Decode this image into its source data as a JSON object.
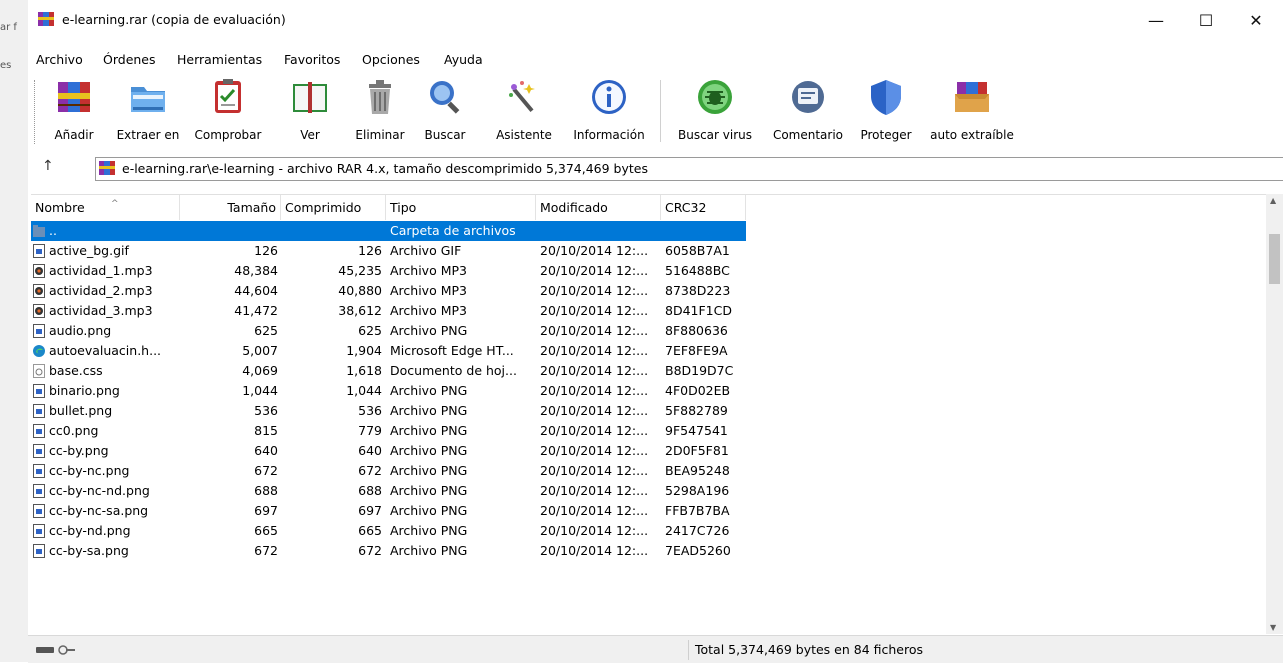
{
  "left_edge": {
    "texts": [
      "ar f",
      "es"
    ]
  },
  "window": {
    "title": "e-learning.rar (copia de evaluación)",
    "minimize": "—",
    "maximize": "☐",
    "close": "✕"
  },
  "menu": [
    "Archivo",
    "Órdenes",
    "Herramientas",
    "Favoritos",
    "Opciones",
    "Ayuda"
  ],
  "toolbar": [
    {
      "label": "Añadir",
      "icon": "add-books-icon"
    },
    {
      "label": "Extraer en",
      "icon": "extract-folder-icon"
    },
    {
      "label": "Comprobar",
      "icon": "test-clipboard-icon"
    },
    {
      "label": "Ver",
      "icon": "view-book-icon"
    },
    {
      "label": "Eliminar",
      "icon": "trash-icon"
    },
    {
      "label": "Buscar",
      "icon": "magnifier-icon"
    },
    {
      "label": "Asistente",
      "icon": "wizard-wand-icon"
    },
    {
      "label": "Información",
      "icon": "info-icon"
    },
    {
      "label": "Buscar virus",
      "icon": "virus-scan-icon"
    },
    {
      "label": "Comentario",
      "icon": "comment-icon"
    },
    {
      "label": "Proteger",
      "icon": "shield-icon"
    },
    {
      "label": "auto extraíble",
      "icon": "sfx-box-icon"
    }
  ],
  "address": {
    "up": "↑",
    "path": "e-learning.rar\\e-learning - archivo RAR 4.x, tamaño descomprimido 5,374,469 bytes"
  },
  "columns": {
    "name": "Nombre",
    "size": "Tamaño",
    "packed": "Comprimido",
    "type": "Tipo",
    "modified": "Modificado",
    "crc": "CRC32"
  },
  "rows": [
    {
      "name": "..",
      "size": "",
      "packed": "",
      "type": "Carpeta de archivos",
      "modified": "",
      "crc": "",
      "icon": "folder-up-icon",
      "selected": true
    },
    {
      "name": "active_bg.gif",
      "size": "126",
      "packed": "126",
      "type": "Archivo GIF",
      "modified": "20/10/2014 12:...",
      "crc": "6058B7A1",
      "icon": "image-file-icon"
    },
    {
      "name": "actividad_1.mp3",
      "size": "48,384",
      "packed": "45,235",
      "type": "Archivo MP3",
      "modified": "20/10/2014 12:...",
      "crc": "516488BC",
      "icon": "audio-file-icon"
    },
    {
      "name": "actividad_2.mp3",
      "size": "44,604",
      "packed": "40,880",
      "type": "Archivo MP3",
      "modified": "20/10/2014 12:...",
      "crc": "8738D223",
      "icon": "audio-file-icon"
    },
    {
      "name": "actividad_3.mp3",
      "size": "41,472",
      "packed": "38,612",
      "type": "Archivo MP3",
      "modified": "20/10/2014 12:...",
      "crc": "8D41F1CD",
      "icon": "audio-file-icon"
    },
    {
      "name": "audio.png",
      "size": "625",
      "packed": "625",
      "type": "Archivo PNG",
      "modified": "20/10/2014 12:...",
      "crc": "8F880636",
      "icon": "image-file-icon"
    },
    {
      "name": "autoevaluacin.h...",
      "size": "5,007",
      "packed": "1,904",
      "type": "Microsoft Edge HT...",
      "modified": "20/10/2014 12:...",
      "crc": "7EF8FE9A",
      "icon": "edge-icon"
    },
    {
      "name": "base.css",
      "size": "4,069",
      "packed": "1,618",
      "type": "Documento de hoj...",
      "modified": "20/10/2014 12:...",
      "crc": "B8D19D7C",
      "icon": "css-file-icon"
    },
    {
      "name": "binario.png",
      "size": "1,044",
      "packed": "1,044",
      "type": "Archivo PNG",
      "modified": "20/10/2014 12:...",
      "crc": "4F0D02EB",
      "icon": "image-file-icon"
    },
    {
      "name": "bullet.png",
      "size": "536",
      "packed": "536",
      "type": "Archivo PNG",
      "modified": "20/10/2014 12:...",
      "crc": "5F882789",
      "icon": "image-file-icon"
    },
    {
      "name": "cc0.png",
      "size": "815",
      "packed": "779",
      "type": "Archivo PNG",
      "modified": "20/10/2014 12:...",
      "crc": "9F547541",
      "icon": "image-file-icon"
    },
    {
      "name": "cc-by.png",
      "size": "640",
      "packed": "640",
      "type": "Archivo PNG",
      "modified": "20/10/2014 12:...",
      "crc": "2D0F5F81",
      "icon": "image-file-icon"
    },
    {
      "name": "cc-by-nc.png",
      "size": "672",
      "packed": "672",
      "type": "Archivo PNG",
      "modified": "20/10/2014 12:...",
      "crc": "BEA95248",
      "icon": "image-file-icon"
    },
    {
      "name": "cc-by-nc-nd.png",
      "size": "688",
      "packed": "688",
      "type": "Archivo PNG",
      "modified": "20/10/2014 12:...",
      "crc": "5298A196",
      "icon": "image-file-icon"
    },
    {
      "name": "cc-by-nc-sa.png",
      "size": "697",
      "packed": "697",
      "type": "Archivo PNG",
      "modified": "20/10/2014 12:...",
      "crc": "FFB7B7BA",
      "icon": "image-file-icon"
    },
    {
      "name": "cc-by-nd.png",
      "size": "665",
      "packed": "665",
      "type": "Archivo PNG",
      "modified": "20/10/2014 12:...",
      "crc": "2417C726",
      "icon": "image-file-icon"
    },
    {
      "name": "cc-by-sa.png",
      "size": "672",
      "packed": "672",
      "type": "Archivo PNG",
      "modified": "20/10/2014 12:...",
      "crc": "7EAD5260",
      "icon": "image-file-icon"
    }
  ],
  "status": {
    "text": "Total 5,374,469 bytes en 84 ficheros",
    "icon": "drive-key-icon"
  },
  "colors": {
    "selection": "#0078d7",
    "background": "#ffffff",
    "chrome": "#f0f0f0"
  }
}
